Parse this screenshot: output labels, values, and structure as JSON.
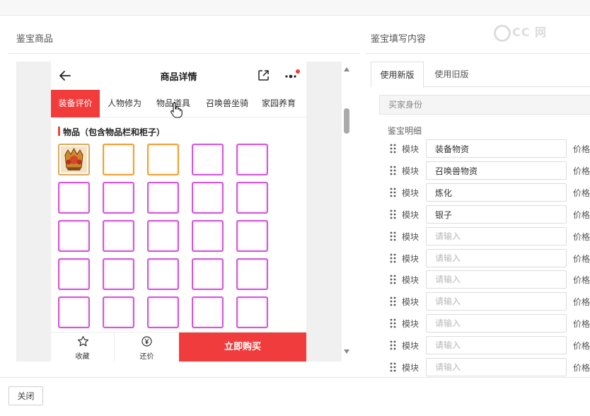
{
  "page": {
    "left_title": "鉴宝商品",
    "right_title": "鉴宝填写内容",
    "watermark": "CC 网"
  },
  "phone": {
    "title": "商品详情",
    "tabs": [
      {
        "label": "装备评价",
        "active": true
      },
      {
        "label": "人物修为",
        "active": false
      },
      {
        "label": "物品道具",
        "active": false
      },
      {
        "label": "召唤兽坐骑",
        "active": false
      },
      {
        "label": "家园养育",
        "active": false
      }
    ],
    "items_heading": "物品（包含物品栏和柜子）",
    "footer": {
      "favorite_label": "收藏",
      "counter_offer_label": "还价",
      "buy_label": "立即购买"
    },
    "notification_dot_color": "#f23b3b"
  },
  "editor": {
    "tabs": [
      {
        "label": "使用新版",
        "active": true
      },
      {
        "label": "使用旧版",
        "active": false
      }
    ],
    "buyer_identity_label": "买家身份",
    "detail_label": "鉴宝明细",
    "module_label": "模块",
    "price_label": "价格",
    "input_placeholder": "请输入",
    "modules": [
      {
        "value": "装备物资"
      },
      {
        "value": "召唤兽物资"
      },
      {
        "value": "炼化"
      },
      {
        "value": "银子"
      },
      {
        "value": ""
      },
      {
        "value": ""
      },
      {
        "value": ""
      },
      {
        "value": ""
      },
      {
        "value": ""
      },
      {
        "value": ""
      },
      {
        "value": ""
      }
    ]
  },
  "footer": {
    "close_label": "关闭"
  },
  "colors": {
    "accent_red": "#f03c3c",
    "slot_purple": "#d05ad8",
    "slot_orange": "#f0a033"
  }
}
